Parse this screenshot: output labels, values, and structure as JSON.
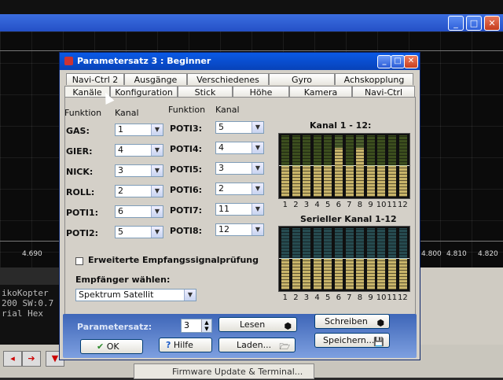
{
  "background": {
    "axis_labels": [
      "4.690",
      "4.800",
      "4.810",
      "4.820"
    ],
    "console_lines": [
      "ikoKopter",
      "200 SW:0.7",
      "rial Hex"
    ]
  },
  "dialog": {
    "title": "Parametersatz 3 : Beginner",
    "tabs_row1": [
      "Navi-Ctrl 2",
      "Ausgänge",
      "Verschiedenes",
      "Gyro",
      "Achskopplung"
    ],
    "tabs_row2": [
      "Kanäle",
      "Konfiguration",
      "Stick",
      "Höhe",
      "Kamera",
      "Navi-Ctrl"
    ],
    "col_headers": {
      "funktion": "Funktion",
      "kanal": "Kanal"
    },
    "left_channels": [
      {
        "name": "GAS:",
        "value": "1"
      },
      {
        "name": "GIER:",
        "value": "4"
      },
      {
        "name": "NICK:",
        "value": "3"
      },
      {
        "name": "ROLL:",
        "value": "2"
      },
      {
        "name": "POTI1:",
        "value": "6"
      },
      {
        "name": "POTI2:",
        "value": "5"
      }
    ],
    "right_channels": [
      {
        "name": "POTI3:",
        "value": "5"
      },
      {
        "name": "POTI4:",
        "value": "4"
      },
      {
        "name": "POTI5:",
        "value": "3"
      },
      {
        "name": "POTI6:",
        "value": "2"
      },
      {
        "name": "POTI7:",
        "value": "11"
      },
      {
        "name": "POTI8:",
        "value": "12"
      }
    ],
    "graph1": {
      "title": "Kanal 1 - 12:",
      "levels": [
        0.5,
        0.5,
        0.5,
        0.5,
        0.5,
        0.8,
        0.5,
        0.8,
        0.5,
        0.5,
        0.5,
        0.5
      ],
      "colors": [
        "#8fc23a",
        "#8fc23a",
        "#8fc23a",
        "#8fc23a",
        "#8fc23a",
        "#b8ef60",
        "#8fc23a",
        "#b8ef60",
        "#8fc23a",
        "#8fc23a",
        "#8fc23a",
        "#8fc23a"
      ]
    },
    "graph2": {
      "title": "Serieller Kanal 1-12",
      "levels": [
        0.5,
        0.5,
        0.5,
        0.5,
        0.5,
        0.5,
        0.5,
        0.5,
        0.5,
        0.5,
        0.5,
        0.5
      ],
      "color": "#4fb8c8"
    },
    "channel_numbers": [
      "1",
      "2",
      "3",
      "4",
      "5",
      "6",
      "7",
      "8",
      "9",
      "10",
      "11",
      "12"
    ],
    "checkbox_label": "Erweiterte Empfangssignalprüfung",
    "receiver_label": "Empfänger wählen:",
    "receiver_value": "Spektrum Satellit",
    "bottom": {
      "parametersatz_label": "Parametersatz:",
      "parametersatz_value": "3",
      "lesen": "Lesen",
      "schreiben": "Schreiben",
      "ok": "OK",
      "hilfe": "Hilfe",
      "laden": "Laden...",
      "speichern": "Speichern..."
    }
  },
  "panel": {
    "firmware_button": "Firmware Update & Terminal..."
  }
}
